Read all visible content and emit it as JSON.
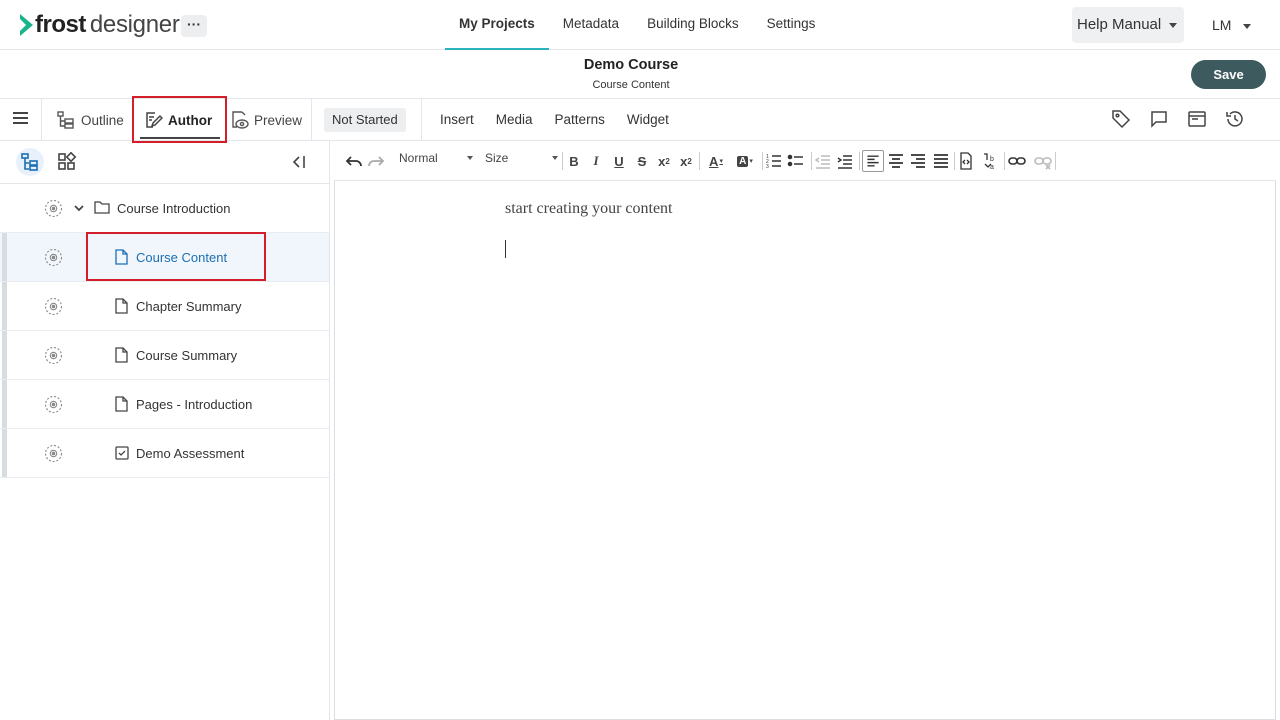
{
  "app": {
    "logo_bold": "frost",
    "logo_light": "designer",
    "more_label": "···",
    "brand_color": "#1bb38a"
  },
  "nav": {
    "tabs": [
      {
        "label": "My Projects",
        "active": true
      },
      {
        "label": "Metadata",
        "active": false
      },
      {
        "label": "Building Blocks",
        "active": false
      },
      {
        "label": "Settings",
        "active": false
      }
    ],
    "help_label": "Help Manual",
    "user_initials": "LM"
  },
  "titlebar": {
    "course_title": "Demo Course",
    "course_subtitle": "Course Content",
    "save_label": "Save"
  },
  "toolbar": {
    "modes": [
      {
        "label": "Outline",
        "icon": "outline-icon",
        "active": false
      },
      {
        "label": "Author",
        "icon": "author-icon",
        "active": true
      },
      {
        "label": "Preview",
        "icon": "preview-icon",
        "active": false
      }
    ],
    "status": "Not Started",
    "menu": [
      "Insert",
      "Media",
      "Patterns",
      "Widget"
    ],
    "right_icons": [
      "tag-icon",
      "comment-icon",
      "panel-icon",
      "history-icon"
    ]
  },
  "tree": {
    "items": [
      {
        "label": "Course Introduction",
        "type": "folder",
        "expanded": true
      },
      {
        "label": "Course Content",
        "type": "page",
        "selected": true
      },
      {
        "label": "Chapter Summary",
        "type": "page"
      },
      {
        "label": "Course Summary",
        "type": "page"
      },
      {
        "label": "Pages - Introduction",
        "type": "page"
      },
      {
        "label": "Demo Assessment",
        "type": "assessment"
      }
    ]
  },
  "editor": {
    "format_select": "Normal",
    "size_select": "Size",
    "placeholder": "start creating your content"
  }
}
